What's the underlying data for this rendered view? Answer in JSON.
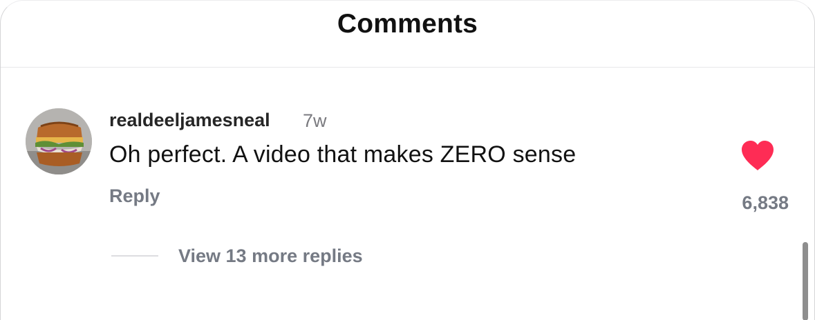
{
  "header": {
    "title": "Comments"
  },
  "comment": {
    "username": "realdeeljamesneal",
    "time_ago": "7w",
    "text": "Oh perfect. A video that makes ZERO sense",
    "reply_label": "Reply",
    "like_count": "6,838",
    "liked": true,
    "avatar_icon": "sandwich-avatar",
    "like_icon": "heart-icon",
    "view_replies_label": "View 13 more replies"
  },
  "colors": {
    "heart": "#fe2c55",
    "secondary_text": "#757a84",
    "primary_text": "#111111"
  }
}
